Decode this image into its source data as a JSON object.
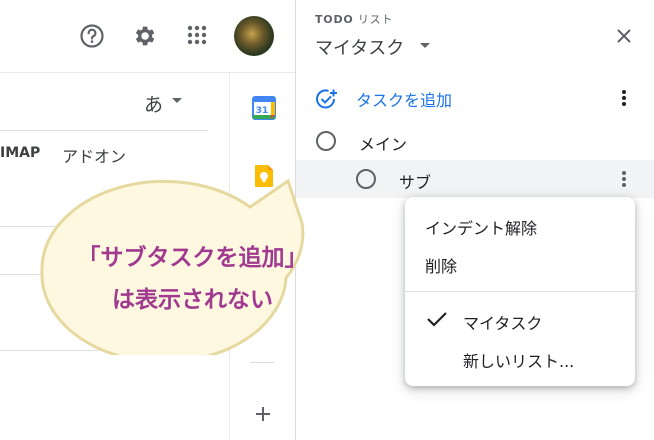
{
  "header": {
    "help_icon": "help-circle-icon",
    "settings_icon": "gear-icon",
    "apps_icon": "apps-grid-icon",
    "avatar_icon": "account-avatar"
  },
  "settings": {
    "language_char": "あ",
    "tab_imap": "IMAP",
    "tab_addons": "アドオン"
  },
  "side_rail": {
    "calendar_icon": "calendar-icon",
    "calendar_day": "31",
    "keep_icon": "keep-bulb-icon",
    "add_icon": "plus-icon"
  },
  "tasks_panel": {
    "app_name_bold": "TODO",
    "app_name_rest": " リスト",
    "list_name": "マイタスク",
    "add_task_label": "タスクを追加",
    "tasks": [
      {
        "title": "メイン"
      },
      {
        "title": "サブ"
      }
    ]
  },
  "context_menu": {
    "items": [
      {
        "label": "インデント解除"
      },
      {
        "label": "削除"
      },
      {
        "label": "マイタスク",
        "checked": true
      },
      {
        "label": "新しいリスト..."
      }
    ]
  },
  "callout": {
    "line1": "「サブタスクを追加」",
    "line2": "は表示されない"
  },
  "colors": {
    "accent_blue": "#1a73e8",
    "callout_text": "#a0398f",
    "callout_fill": "#fdf8df",
    "callout_border": "#e6d9a0"
  }
}
